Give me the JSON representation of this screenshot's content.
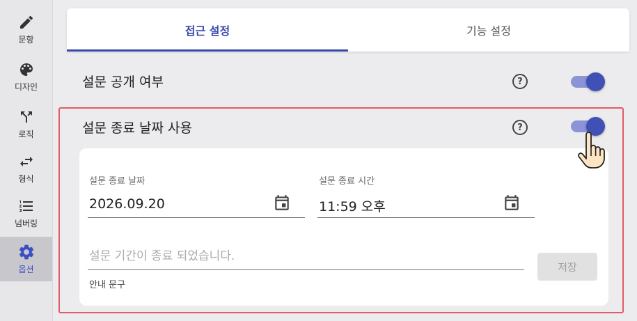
{
  "sidebar": {
    "items": [
      {
        "label": "문항",
        "icon": "pencil-icon"
      },
      {
        "label": "디자인",
        "icon": "palette-icon"
      },
      {
        "label": "로직",
        "icon": "fork-arrows-icon"
      },
      {
        "label": "형식",
        "icon": "swap-arrows-icon"
      },
      {
        "label": "넘버링",
        "icon": "numbered-list-icon"
      },
      {
        "label": "옵션",
        "icon": "gear-icon"
      }
    ],
    "active_index": 5
  },
  "tabs": [
    {
      "label": "접근 설정",
      "active": true
    },
    {
      "label": "기능 설정",
      "active": false
    }
  ],
  "settings": {
    "public": {
      "label": "설문 공개 여부",
      "enabled": true
    },
    "end_date": {
      "label": "설문 종료 날짜 사용",
      "enabled": true
    }
  },
  "end_fields": {
    "date_label": "설문 종료 날짜",
    "date_value": "2026.09.20",
    "time_label": "설문 종료 시간",
    "time_value": "11:59 오후",
    "message_placeholder": "설문 기간이 종료 되었습니다.",
    "message_helper": "안내 문구",
    "save_label": "저장"
  },
  "colors": {
    "accent": "#3949ab",
    "toggle_track": "#8a94d6",
    "highlight_border": "#e25b67",
    "sidebar_active_bg": "#c7c7cc"
  }
}
